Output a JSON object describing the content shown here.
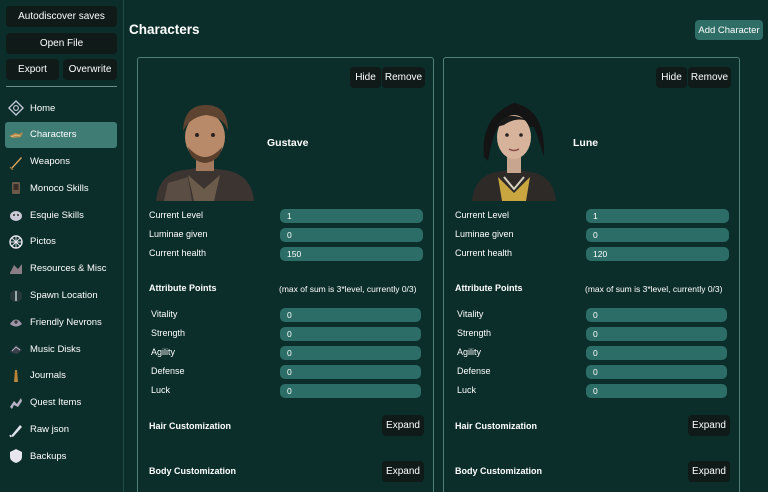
{
  "sidebar": {
    "autodiscover_label": "Autodiscover saves",
    "open_file_label": "Open File",
    "export_label": "Export",
    "overwrite_label": "Overwrite",
    "items": [
      {
        "label": "Home",
        "icon": "home-icon"
      },
      {
        "label": "Characters",
        "icon": "characters-icon",
        "active": true
      },
      {
        "label": "Weapons",
        "icon": "weapons-icon"
      },
      {
        "label": "Monoco Skills",
        "icon": "monoco-skills-icon"
      },
      {
        "label": "Esquie Skills",
        "icon": "esquie-skills-icon"
      },
      {
        "label": "Pictos",
        "icon": "pictos-icon"
      },
      {
        "label": "Resources & Misc",
        "icon": "resources-icon"
      },
      {
        "label": "Spawn Location",
        "icon": "spawn-location-icon"
      },
      {
        "label": "Friendly Nevrons",
        "icon": "nevrons-icon"
      },
      {
        "label": "Music Disks",
        "icon": "music-disks-icon"
      },
      {
        "label": "Journals",
        "icon": "journals-icon"
      },
      {
        "label": "Quest Items",
        "icon": "quest-items-icon"
      },
      {
        "label": "Raw json",
        "icon": "raw-json-icon"
      },
      {
        "label": "Backups",
        "icon": "backups-icon"
      }
    ]
  },
  "main": {
    "title": "Characters",
    "add_character_label": "Add Character",
    "characters": [
      {
        "name": "Gustave",
        "hide_label": "Hide",
        "remove_label": "Remove",
        "current_level_label": "Current Level",
        "current_level": "1",
        "luminae_label": "Luminae given",
        "luminae": "0",
        "health_label": "Current health",
        "health": "150",
        "attr_title": "Attribute Points",
        "attr_note": "(max of sum is 3*level, currently 0/3)",
        "attributes": [
          {
            "label": "Vitality",
            "value": "0"
          },
          {
            "label": "Strength",
            "value": "0"
          },
          {
            "label": "Agility",
            "value": "0"
          },
          {
            "label": "Defense",
            "value": "0"
          },
          {
            "label": "Luck",
            "value": "0"
          }
        ],
        "hair_label": "Hair Customization",
        "body_label": "Body Customization",
        "expand_label": "Expand"
      },
      {
        "name": "Lune",
        "hide_label": "Hide",
        "remove_label": "Remove",
        "current_level_label": "Current Level",
        "current_level": "1",
        "luminae_label": "Luminae given",
        "luminae": "0",
        "health_label": "Current health",
        "health": "120",
        "attr_title": "Attribute Points",
        "attr_note": "(max of sum is 3*level, currently 0/3)",
        "attributes": [
          {
            "label": "Vitality",
            "value": "0"
          },
          {
            "label": "Strength",
            "value": "0"
          },
          {
            "label": "Agility",
            "value": "0"
          },
          {
            "label": "Defense",
            "value": "0"
          },
          {
            "label": "Luck",
            "value": "0"
          }
        ],
        "hair_label": "Hair Customization",
        "body_label": "Body Customization",
        "expand_label": "Expand"
      }
    ]
  },
  "colors": {
    "background": "#0b2e2b",
    "active_nav": "#3e7c74",
    "value_field": "#2c6e67",
    "dark_button": "#0f1a19"
  }
}
